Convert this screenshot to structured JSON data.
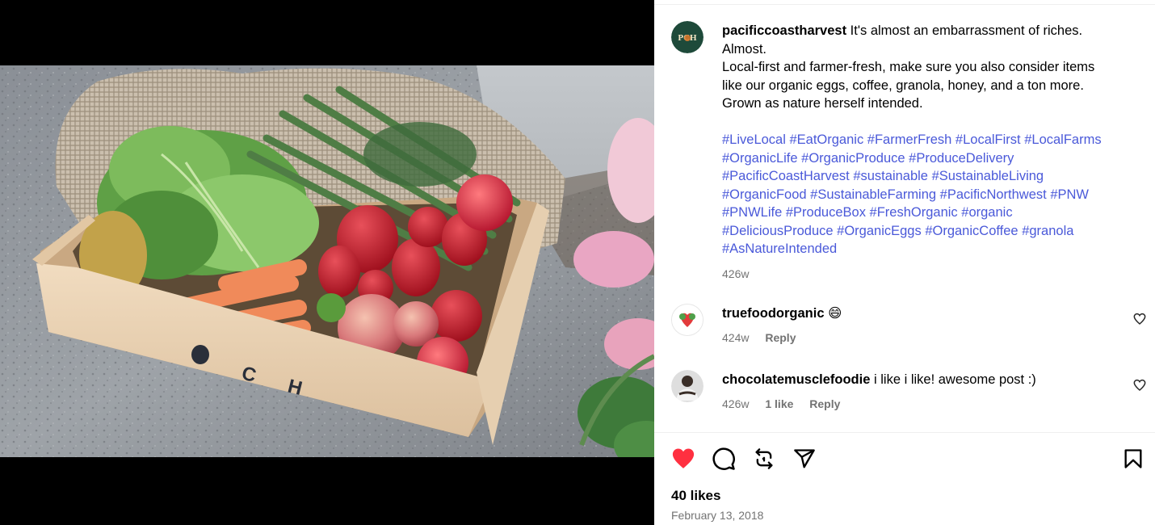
{
  "post": {
    "image_alt": "wooden crate with lettuce, asparagus, strawberries, carrots and apples",
    "crate_stamp": "PCH"
  },
  "author": {
    "username": "pacificcoastharvest",
    "avatar_text": "PCH",
    "avatar_color": "#1e4a3a"
  },
  "caption": {
    "lines": [
      "It's almost an embarrassment of riches.",
      "Almost.",
      "Local-first and farmer-fresh, make sure you also consider items",
      "like our organic eggs, coffee, granola, honey, and a ton more.",
      "Grown as nature herself intended."
    ],
    "hashtags": [
      "#LiveLocal",
      "#EatOrganic",
      "#FarmerFresh",
      "#LocalFirst",
      "#LocalFarms",
      "#OrganicLife",
      "#OrganicProduce",
      "#ProduceDelivery",
      "#PacificCoastHarvest",
      "#sustainable",
      "#SustainableLiving",
      "#OrganicFood",
      "#SustainableFarming",
      "#PacificNorthwest",
      "#PNW",
      "#PNWLife",
      "#ProduceBox",
      "#FreshOrganic",
      "#organic",
      "#DeliciousProduce",
      "#OrganicEggs",
      "#OrganicCoffee",
      "#granola",
      "#AsNatureIntended"
    ],
    "hashtag_rows": [
      [
        0,
        1,
        2,
        3,
        4
      ],
      [
        5,
        6,
        7
      ],
      [
        8,
        9,
        10
      ],
      [
        11,
        12,
        13,
        14
      ],
      [
        15,
        16,
        17,
        18
      ],
      [
        19,
        20,
        21,
        22
      ],
      [
        23
      ]
    ],
    "age": "426w"
  },
  "comments": [
    {
      "username": "truefoodorganic",
      "text": "😄",
      "age": "424w",
      "likes": "",
      "reply_label": "Reply"
    },
    {
      "username": "chocolatemusclefoodie",
      "text": "i like i like! awesome post :)",
      "age": "426w",
      "likes": "1 like",
      "reply_label": "Reply"
    }
  ],
  "actions": {
    "liked": true,
    "like_icon": "heart-filled-icon",
    "comment_icon": "comment-bubble-icon",
    "repost_icon": "repost-icon",
    "share_icon": "share-icon",
    "save_icon": "bookmark-icon",
    "like_color": "#ff3040"
  },
  "footer": {
    "likes": "40 likes",
    "date": "February 13, 2018"
  },
  "colors": {
    "hashtag": "#4a59d9",
    "muted": "#737373"
  }
}
